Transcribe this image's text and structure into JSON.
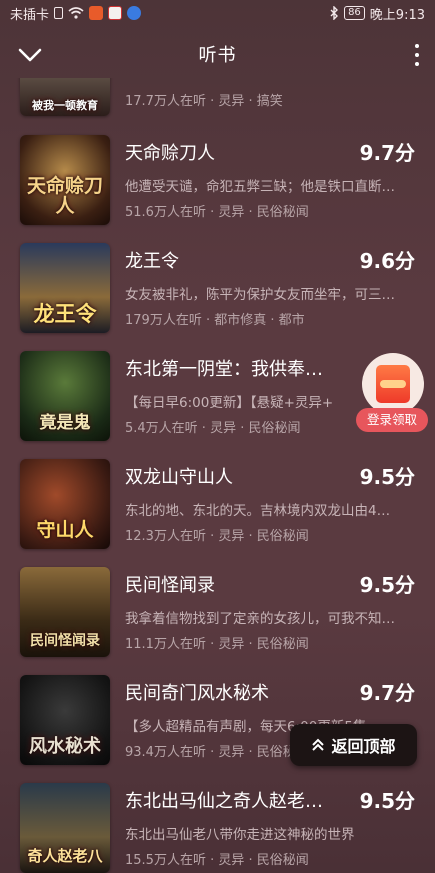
{
  "status_bar": {
    "carrier": "未插卡",
    "battery": "86",
    "time": "晚上9:13"
  },
  "header": {
    "title": "听书"
  },
  "books": [
    {
      "cover_text": "被我一顿教育",
      "title": "",
      "score": "",
      "desc": "",
      "meta": "17.7万人在听 · 灵异 · 搞笑"
    },
    {
      "cover_text": "天命赊刀人",
      "title": "天命赊刀人",
      "score": "9.7分",
      "desc": "他遭受天谴，命犯五弊三缺；他是铁口直断…",
      "meta": "51.6万人在听 · 灵异 · 民俗秘闻"
    },
    {
      "cover_text": "龙王令",
      "title": "龙王令",
      "score": "9.6分",
      "desc": "女友被非礼，陈平为保护女友而坐牢，可三…",
      "meta": "179万人在听 · 都市修真 · 都市"
    },
    {
      "cover_text": "竟是鬼",
      "title": "东北第一阴堂：我供奉…",
      "score": "",
      "desc": "【每日早6:00更新】【悬疑+灵异+",
      "meta": "5.4万人在听 · 灵异 · 民俗秘闻"
    },
    {
      "cover_text": "守山人",
      "title": "双龙山守山人",
      "score": "9.5分",
      "desc": "东北的地、东北的天。吉林境内双龙山由4…",
      "meta": "12.3万人在听 · 灵异 · 民俗秘闻"
    },
    {
      "cover_text": "民间怪闻录",
      "title": "民间怪闻录",
      "score": "9.5分",
      "desc": "我拿着信物找到了定亲的女孩儿，可我不知…",
      "meta": "11.1万人在听 · 灵异 · 民俗秘闻"
    },
    {
      "cover_text": "风水秘术",
      "title": "民间奇门风水秘术",
      "score": "9.7分",
      "desc": "【多人超精品有声剧，每天6:00更新5集",
      "meta": "93.4万人在听 · 灵异 · 民俗秘闻"
    },
    {
      "cover_text": "奇人赵老八",
      "title": "东北出马仙之奇人赵老…",
      "score": "9.5分",
      "desc": "东北出马仙老八带你走进这神秘的世界",
      "meta": "15.5万人在听 · 灵异 · 民俗秘闻"
    }
  ],
  "promo": {
    "label": "登录领取"
  },
  "back_to_top": {
    "label": "返回顶部"
  },
  "colors": {
    "accent_red": "#e7565c",
    "score_white": "#ffffff",
    "bg": "#5a3a40"
  },
  "icons": [
    "chevron-down-icon",
    "more-vertical-icon",
    "red-envelope-icon",
    "double-chevron-up-icon"
  ]
}
